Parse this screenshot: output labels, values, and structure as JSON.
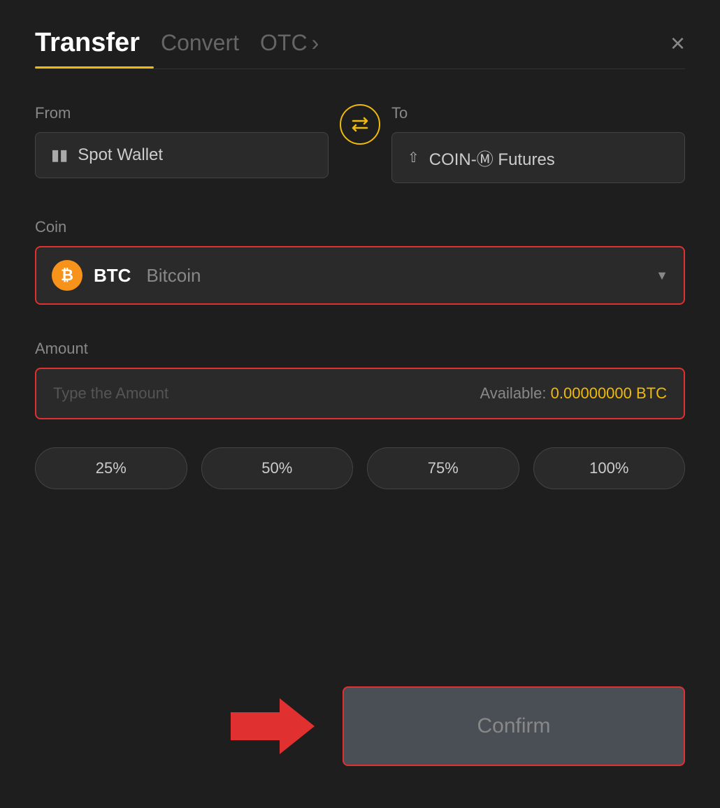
{
  "header": {
    "tab_transfer": "Transfer",
    "tab_convert": "Convert",
    "tab_otc": "OTC",
    "tab_otc_chevron": "›",
    "close_icon": "×"
  },
  "from": {
    "label": "From",
    "wallet_icon": "▬",
    "wallet_name": "Spot Wallet"
  },
  "to": {
    "label": "To",
    "futures_icon": "↑",
    "futures_name": "COIN-Ⓜ Futures"
  },
  "coin": {
    "label": "Coin",
    "symbol": "BTC",
    "name": "Bitcoin",
    "btc_letter": "₿"
  },
  "amount": {
    "label": "Amount",
    "placeholder": "Type the Amount",
    "available_label": "Available:",
    "available_value": "0.00000000 BTC"
  },
  "percent_buttons": [
    "25%",
    "50%",
    "75%",
    "100%"
  ],
  "confirm_button": "Confirm"
}
